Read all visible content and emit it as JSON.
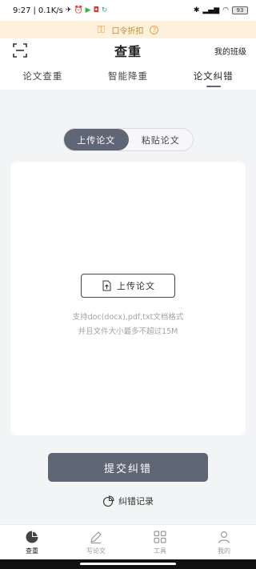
{
  "status_bar": {
    "time": "9:27",
    "speed": "0.1K/s",
    "battery": "93"
  },
  "promo": {
    "label": "口令折扣",
    "help_glyph": "?"
  },
  "header": {
    "title": "查重",
    "right_link": "我的班级"
  },
  "tabs": [
    {
      "label": "论文查重",
      "active": false
    },
    {
      "label": "智能降重",
      "active": false
    },
    {
      "label": "论文纠错",
      "active": true
    }
  ],
  "segmented": {
    "upload": "上传论文",
    "paste": "粘贴论文"
  },
  "upload_card": {
    "button_label": "上传论文",
    "hint_line1": "支持doc(docx),pdf,txt文档格式",
    "hint_line2": "并且文件大小最多不超过15M"
  },
  "submit_label": "提交纠错",
  "records_label": "纠错记录",
  "bottom_nav": [
    {
      "label": "查重",
      "icon": "pie-chart-icon",
      "active": true
    },
    {
      "label": "写论文",
      "icon": "pen-icon",
      "active": false
    },
    {
      "label": "工具",
      "icon": "grid-icon",
      "active": false
    },
    {
      "label": "我的",
      "icon": "person-icon",
      "active": false
    }
  ],
  "colors": {
    "accent": "#5f6675",
    "promo_bg": "#fdf1dd",
    "promo_text": "#c08a2e",
    "page_bg": "#f3f4f6"
  }
}
